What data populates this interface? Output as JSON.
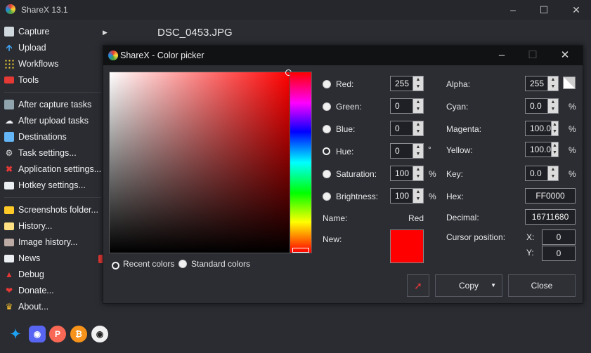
{
  "app": {
    "title": "ShareX 13.1",
    "filename": "DSC_0453.JPG"
  },
  "menu": {
    "capture": "Capture",
    "upload": "Upload",
    "workflows": "Workflows",
    "tools": "Tools",
    "after_capture": "After capture tasks",
    "after_upload": "After upload tasks",
    "destinations": "Destinations",
    "task_settings": "Task settings...",
    "app_settings": "Application settings...",
    "hotkey_settings": "Hotkey settings...",
    "screenshots_folder": "Screenshots folder...",
    "history": "History...",
    "image_history": "Image history...",
    "news": "News",
    "debug": "Debug",
    "donate": "Donate...",
    "about": "About..."
  },
  "dialog": {
    "title": "ShareX - Color picker",
    "labels": {
      "red": "Red:",
      "green": "Green:",
      "blue": "Blue:",
      "hue": "Hue:",
      "saturation": "Saturation:",
      "brightness": "Brightness:",
      "alpha": "Alpha:",
      "cyan": "Cyan:",
      "magenta": "Magenta:",
      "yellow": "Yellow:",
      "key": "Key:",
      "hex": "Hex:",
      "name": "Name:",
      "decimal": "Decimal:",
      "new": "New:",
      "cursor_position": "Cursor position:",
      "x": "X:",
      "y": "Y:"
    },
    "values": {
      "red": "255",
      "green": "0",
      "blue": "0",
      "hue": "0",
      "saturation": "100",
      "brightness": "100",
      "alpha": "255",
      "cyan": "0.0",
      "magenta": "100.0",
      "yellow": "100.0",
      "key": "0.0",
      "hex": "FF0000",
      "name": "Red",
      "decimal": "16711680",
      "x": "0",
      "y": "0"
    },
    "units": {
      "percent": "%",
      "degree": "°"
    },
    "recent_colors": "Recent colors",
    "standard_colors": "Standard colors",
    "copy_button": "Copy",
    "close_button": "Close",
    "new_color": "#ff0000"
  }
}
